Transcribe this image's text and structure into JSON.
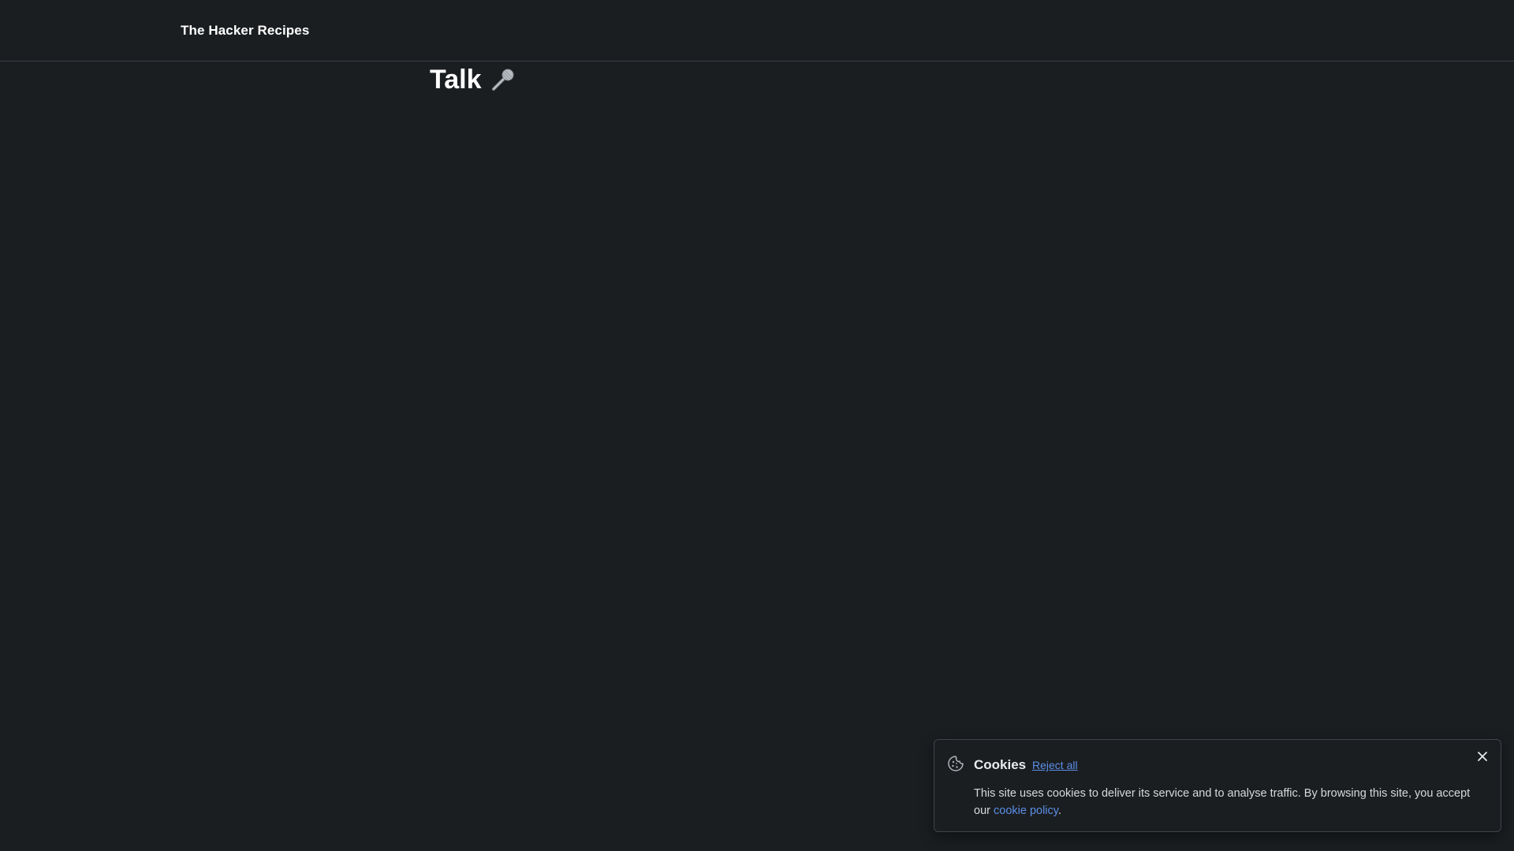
{
  "header": {
    "site_title": "The Hacker Recipes"
  },
  "page": {
    "heading": "Talk",
    "heading_icon": "microphone-icon"
  },
  "cookie_banner": {
    "icon": "cookie-icon",
    "title": "Cookies",
    "reject_label": "Reject all",
    "text_before_link": "This site uses cookies to deliver its service and to analyse traffic. By browsing this site, you accept our ",
    "link_label": "cookie policy",
    "text_after_link": ".",
    "close_icon": "close-icon"
  },
  "colors": {
    "background": "#1b1e21",
    "link": "#5b8ee6",
    "border": "#3f454b"
  }
}
